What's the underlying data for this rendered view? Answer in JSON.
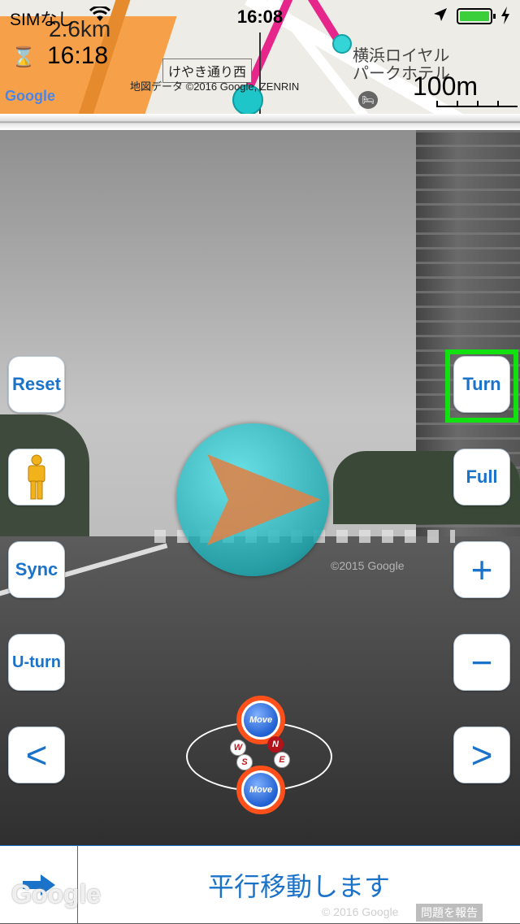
{
  "status_bar": {
    "carrier": "SIMなし",
    "time": "16:08"
  },
  "map": {
    "distance_partial": "2.6km",
    "eta": "16:18",
    "street_name": "けやき通り西",
    "copyright": "地図データ ©2016 Google, ZENRIN",
    "poi_line1": "横浜ロイヤル",
    "poi_line2": "パークホテル",
    "scale": "100m",
    "logo": "Google"
  },
  "left_buttons": {
    "reset": "Reset",
    "sync": "Sync",
    "uturn": "U-turn",
    "prev": "<"
  },
  "right_buttons": {
    "turn": "Turn",
    "full": "Full",
    "zoom_in": "+",
    "zoom_out": "−",
    "next": ">"
  },
  "compass": {
    "move_label": "Move",
    "w": "W",
    "n": "N",
    "s": "S",
    "e": "E"
  },
  "street_view": {
    "watermark": "©2015 Google",
    "logo": "Google",
    "copyright": "© 2016 Google",
    "report": "問題を報告"
  },
  "bottom_bar": {
    "message": "平行移動します"
  },
  "colors": {
    "accent": "#1a72c9",
    "highlight": "#12e010",
    "move_ring": "#ff4f1a",
    "orb": "#1fc6c9",
    "arrow": "#d9844a",
    "route": "#e6268a"
  }
}
